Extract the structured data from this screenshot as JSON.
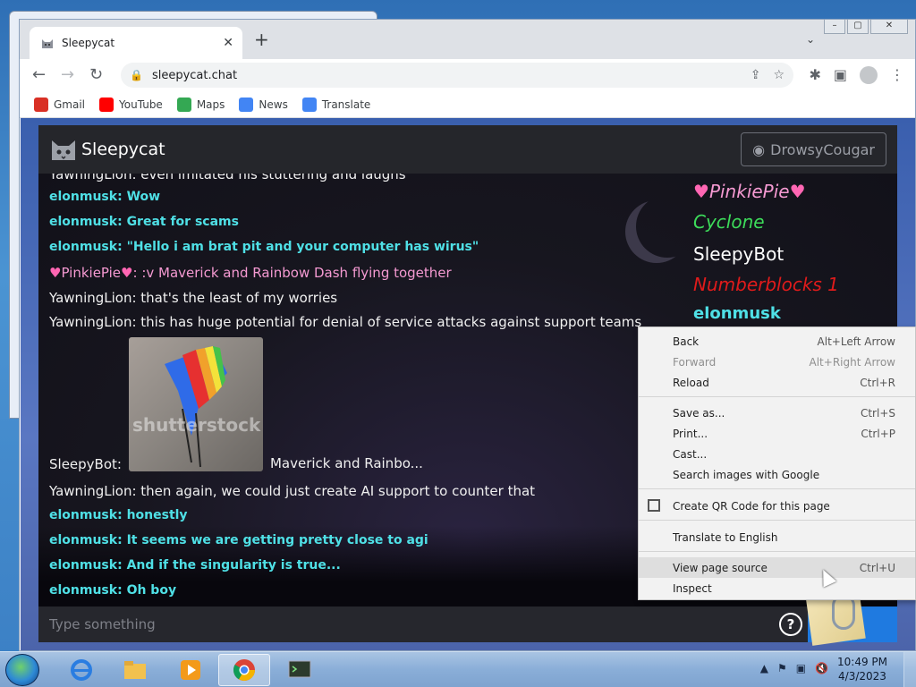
{
  "browser": {
    "tab_title": "Sleepycat",
    "url": "sleepycat.chat",
    "bookmarks": [
      {
        "label": "Gmail",
        "color": "#d93025"
      },
      {
        "label": "YouTube",
        "color": "#ff0000"
      },
      {
        "label": "Maps",
        "color": "#34a853"
      },
      {
        "label": "News",
        "color": "#4285f4"
      },
      {
        "label": "Translate",
        "color": "#4285f4"
      }
    ]
  },
  "app": {
    "title": "Sleepycat",
    "user_button": "DrowsyCougar",
    "composer_placeholder": "Type something",
    "help_label": "?"
  },
  "messages": [
    {
      "sender": "YawningLion",
      "text": "even imitated his stuttering and laughs"
    },
    {
      "sender": "elonmusk",
      "text": "Wow"
    },
    {
      "sender": "elonmusk",
      "text": "Great for scams"
    },
    {
      "sender": "elonmusk",
      "text": "\"Hello i am brat pit and your computer has wirus\""
    },
    {
      "sender": "PinkiePie",
      "text": ":v Maverick and Rainbow Dash flying together"
    },
    {
      "sender": "YawningLion",
      "text": "that's the least of my worries"
    },
    {
      "sender": "YawningLion",
      "text": "this has huge potential for denial of service attacks against support teams"
    },
    {
      "sender": "SleepyBot",
      "text": "Maverick and Rainbo...",
      "image_watermark": "shutterstock"
    },
    {
      "sender": "YawningLion",
      "text": "then again, we could just create AI support to counter that"
    },
    {
      "sender": "elonmusk",
      "text": "honestly"
    },
    {
      "sender": "elonmusk",
      "text": "It seems we are getting pretty close to agi"
    },
    {
      "sender": "elonmusk",
      "text": "And if the singularity is true..."
    },
    {
      "sender": "elonmusk",
      "text": "Oh boy"
    }
  ],
  "users": [
    {
      "name": "PinkiePie",
      "color": "#f59ad2"
    },
    {
      "name": "Cyclone",
      "color": "#3ddc5a"
    },
    {
      "name": "SleepyBot",
      "color": "#ffffff"
    },
    {
      "name": "Numberblocks 1",
      "color": "#e01b1b"
    },
    {
      "name": "elonmusk",
      "color": "#4fe0e6"
    }
  ],
  "context_menu": [
    {
      "label": "Back",
      "shortcut": "Alt+Left Arrow",
      "disabled": false
    },
    {
      "label": "Forward",
      "shortcut": "Alt+Right Arrow",
      "disabled": true
    },
    {
      "label": "Reload",
      "shortcut": "Ctrl+R",
      "disabled": false
    },
    {
      "label": "Save as...",
      "shortcut": "Ctrl+S",
      "disabled": false
    },
    {
      "label": "Print...",
      "shortcut": "Ctrl+P",
      "disabled": false
    },
    {
      "label": "Cast...",
      "shortcut": "",
      "disabled": false
    },
    {
      "label": "Search images with Google",
      "shortcut": "",
      "disabled": false
    },
    {
      "label": "Create QR Code for this page",
      "shortcut": "",
      "disabled": false,
      "icon": "qr-code-icon"
    },
    {
      "label": "Translate to English",
      "shortcut": "",
      "disabled": false
    },
    {
      "label": "View page source",
      "shortcut": "Ctrl+U",
      "disabled": false,
      "hovered": true
    },
    {
      "label": "Inspect",
      "shortcut": "",
      "disabled": false
    }
  ],
  "taskbar": {
    "time": "10:49 PM",
    "date": "4/3/2023"
  }
}
